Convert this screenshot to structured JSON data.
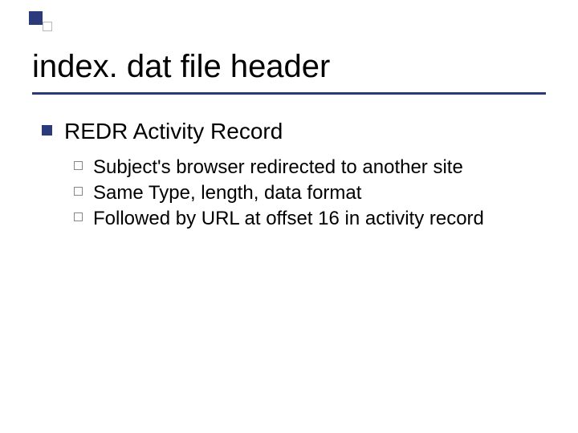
{
  "title": "index. dat file header",
  "level1": {
    "heading": "REDR Activity Record",
    "items": [
      "Subject's browser redirected to another site",
      "Same Type, length, data format",
      "Followed by URL at offset 16 in activity record"
    ]
  }
}
